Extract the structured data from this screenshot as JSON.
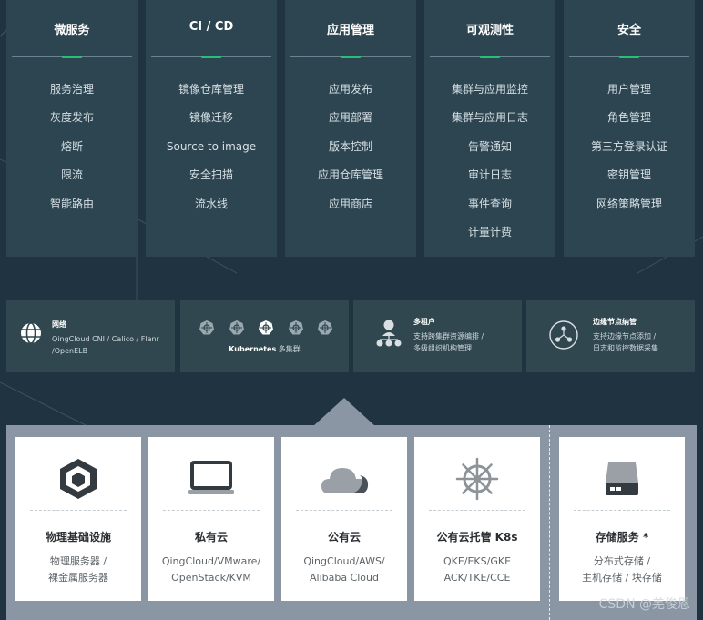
{
  "categories": [
    {
      "title": "微服务",
      "items": [
        "服务治理",
        "灰度发布",
        "熔断",
        "限流",
        "智能路由"
      ]
    },
    {
      "title": "CI / CD",
      "items": [
        "镜像仓库管理",
        "镜像迁移",
        "Source to image",
        "安全扫描",
        "流水线"
      ]
    },
    {
      "title": "应用管理",
      "items": [
        "应用发布",
        "应用部署",
        "版本控制",
        "应用仓库管理",
        "应用商店"
      ]
    },
    {
      "title": "可观测性",
      "items": [
        "集群与应用监控",
        "集群与应用日志",
        "告警通知",
        "审计日志",
        "事件查询",
        "计量计费"
      ]
    },
    {
      "title": "安全",
      "items": [
        "用户管理",
        "角色管理",
        "第三方登录认证",
        "密钥管理",
        "网络策略管理"
      ]
    }
  ],
  "band": {
    "network": {
      "title": "网络",
      "desc_line1": "QingCloud CNI / Calico / Flanr",
      "desc_line2": "/OpenELB"
    },
    "kubernetes": {
      "label_en": "Kubernetes",
      "label_zh": "多集群"
    },
    "tenant": {
      "title": "多租户",
      "desc_line1": "支持跨集群资源编排 /",
      "desc_line2": "多级组织机构管理"
    },
    "edge": {
      "title": "边缘节点纳管",
      "desc_line1": "支持边缘节点添加 /",
      "desc_line2": "日志和监控数据采集"
    }
  },
  "platforms": [
    {
      "icon": "cube-icon",
      "title": "物理基础设施",
      "line1": "物理服务器 /",
      "line2": "裸金属服务器"
    },
    {
      "icon": "laptop-icon",
      "title": "私有云",
      "line1": "QingCloud/VMware/",
      "line2": "OpenStack/KVM"
    },
    {
      "icon": "cloud-icon",
      "title": "公有云",
      "line1": "QingCloud/AWS/",
      "line2": "Alibaba Cloud"
    },
    {
      "icon": "helm-icon",
      "title": "公有云托管 K8s",
      "line1": "QKE/EKS/GKE",
      "line2": "ACK/TKE/CCE"
    },
    {
      "icon": "storage-icon",
      "title": "存储服务 *",
      "line1": "分布式存储 /",
      "line2": "主机存储 / 块存储"
    }
  ],
  "watermark": "CSDN @羌俊恩",
  "colors": {
    "background": "#1f3440",
    "card": "#2d4550",
    "accent": "#27c07a",
    "platform": "#8a96a3"
  }
}
